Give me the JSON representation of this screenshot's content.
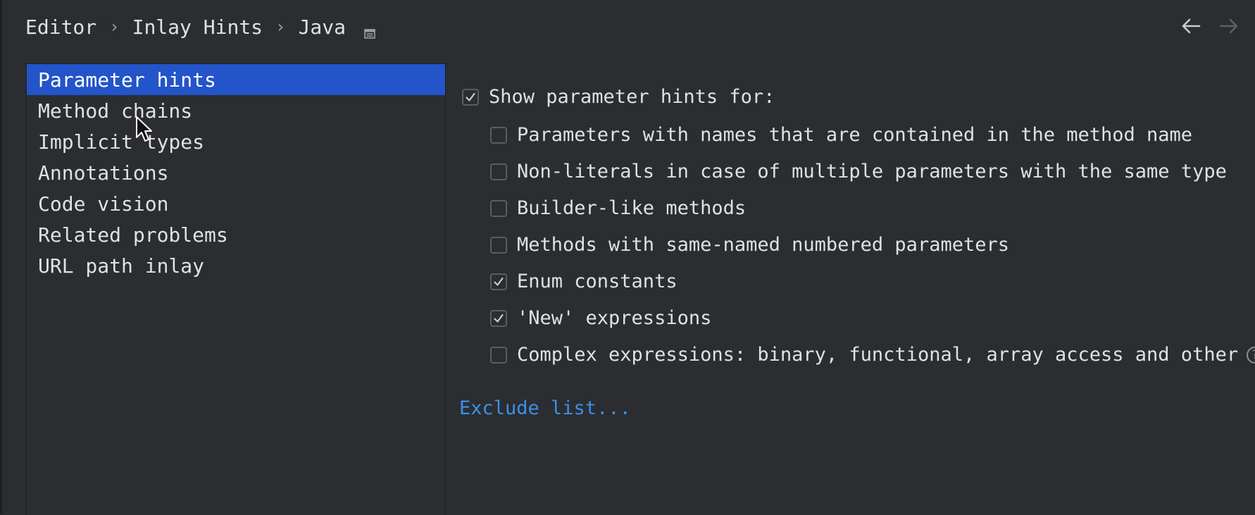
{
  "breadcrumb": {
    "items": [
      "Editor",
      "Inlay Hints",
      "Java"
    ],
    "separator": "›",
    "icon": "window-icon"
  },
  "nav": {
    "back_icon": "arrow-left-icon",
    "forward_icon": "arrow-right-icon"
  },
  "sidebar": {
    "items": [
      {
        "label": "Parameter hints",
        "selected": true
      },
      {
        "label": "Method chains",
        "selected": false
      },
      {
        "label": "Implicit types",
        "selected": false
      },
      {
        "label": "Annotations",
        "selected": false
      },
      {
        "label": "Code vision",
        "selected": false
      },
      {
        "label": "Related problems",
        "selected": false
      },
      {
        "label": "URL path inlay",
        "selected": false
      }
    ]
  },
  "options": {
    "main": {
      "label": "Show parameter hints for:",
      "checked": true
    },
    "sub": [
      {
        "label": "Parameters with names that are contained in the method name",
        "checked": false
      },
      {
        "label": "Non-literals in case of multiple parameters with the same type",
        "checked": false
      },
      {
        "label": "Builder-like methods",
        "checked": false
      },
      {
        "label": "Methods with same-named numbered parameters",
        "checked": false
      },
      {
        "label": "Enum constants",
        "checked": true
      },
      {
        "label": "'New' expressions",
        "checked": true
      },
      {
        "label": "Complex expressions: binary, functional, array access and other",
        "checked": false,
        "help": "?"
      }
    ],
    "exclude_link": "Exclude list..."
  },
  "colors": {
    "background": "#2b2d30",
    "selection": "#2354c9",
    "link": "#3d8fe8",
    "text": "#dfe1e5"
  }
}
